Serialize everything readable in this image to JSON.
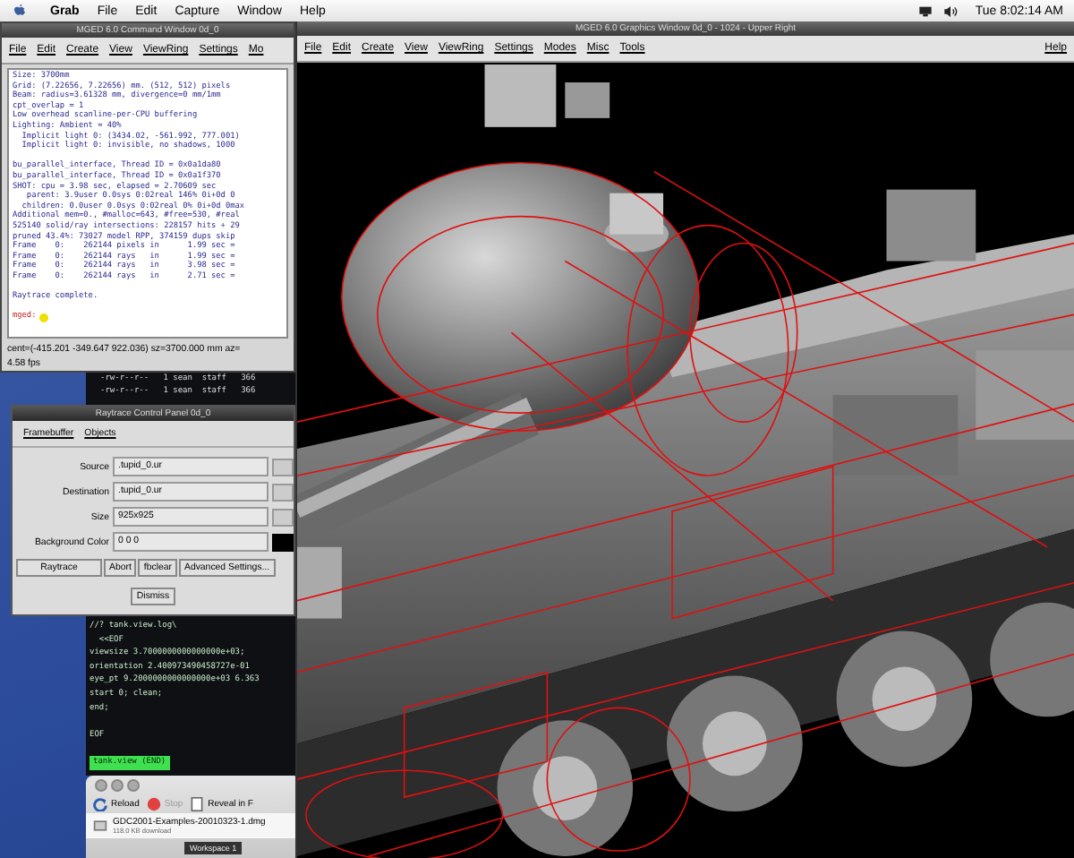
{
  "menu_bar": {
    "app": "Grab",
    "items": [
      "File",
      "Edit",
      "Capture",
      "Window",
      "Help"
    ],
    "clock": "Tue 8:02:14 AM"
  },
  "command_window": {
    "title": "MGED 6.0 Command Window 0d_0",
    "menu": [
      "File",
      "Edit",
      "Create",
      "View",
      "ViewRing",
      "Settings",
      "Mo"
    ],
    "output_blocks": [
      [
        "Size: 3700mm",
        "Grid: (7.22656, 7.22656) mm. (512, 512) pixels",
        "Beam: radius=3.61328 mm, divergence=0 mm/1mm",
        "cpt_overlap = 1",
        "Low overhead scanline-per-CPU buffering",
        "Lighting: Ambient = 40%",
        "  Implicit light 0: (3434.02, -561.992, 777.001)",
        "  Implicit light 0: invisible, no shadows, 1000"
      ],
      [
        "bu_parallel_interface, Thread ID = 0x0a1da80",
        "bu_parallel_interface, Thread ID = 0x0a1f370",
        "SHOT: cpu = 3.98 sec, elapsed = 2.70609 sec",
        "   parent: 3.9user 0.0sys 0:02real 146% 0i+0d 0",
        "  children: 0.0user 0.0sys 0:02real 0% 0i+0d 0max",
        "Additional mem=0., #malloc=643, #free=530, #real",
        "525140 solid/ray intersections: 228157 hits + 29",
        "pruned 43.4%: 73027 model RPP, 374159 dups skip",
        "Frame    0:    262144 pixels in      1.99 sec =",
        "Frame    0:    262144 rays   in      1.99 sec =",
        "Frame    0:    262144 rays   in      3.98 sec =",
        "Frame    0:    262144 rays   in      2.71 sec ="
      ],
      [
        "Raytrace complete."
      ]
    ],
    "prompt": "mged:",
    "status": [
      "cent=(-415.201 -349.647 922.036) sz=3700.000 mm az=",
      "4.58 fps"
    ]
  },
  "terminal": {
    "top_lines": [
      "-rw-r--r--   1 sean  staff   366",
      "-rw-r--r--   1 sean  staff   366"
    ],
    "blocks": [
      [
        "//? tank.view.log\\",
        "  <<EOF",
        "viewsize 3.7000000000000000e+03;",
        "orientation 2.400973490458727e-01",
        "eye_pt 9.2000000000000000e+03 6.363",
        "start 0; clean;",
        "end;"
      ],
      [
        "EOF"
      ]
    ],
    "highlight": "tank.view (END)"
  },
  "raytrace_panel": {
    "title": "Raytrace Control Panel 0d_0",
    "menu": [
      "Framebuffer",
      "Objects"
    ],
    "fields": [
      {
        "label": "Source",
        "value": ".tupid_0.ur"
      },
      {
        "label": "Destination",
        "value": ".tupid_0.ur"
      },
      {
        "label": "Size",
        "value": "925x925"
      }
    ],
    "background_color": {
      "label": "Background Color",
      "value": "0 0 0"
    },
    "buttons": [
      "Raytrace",
      "Abort",
      "fbclear",
      "Advanced Settings..."
    ],
    "dismiss": "Dismiss"
  },
  "graphics_window": {
    "title": "MGED 6.0 Graphics Window 0d_0 - 1024 - Upper Right",
    "menu": [
      "File",
      "Edit",
      "Create",
      "View",
      "ViewRing",
      "Settings",
      "Modes",
      "Misc",
      "Tools"
    ],
    "help": "Help"
  },
  "download_window": {
    "buttons": [
      "Reload",
      "Stop",
      "Reveal in F"
    ],
    "file": "GDC2001-Examples-20010323-1.dmg",
    "detail": "118.0 KB download"
  },
  "workspace": "Workspace 1"
}
